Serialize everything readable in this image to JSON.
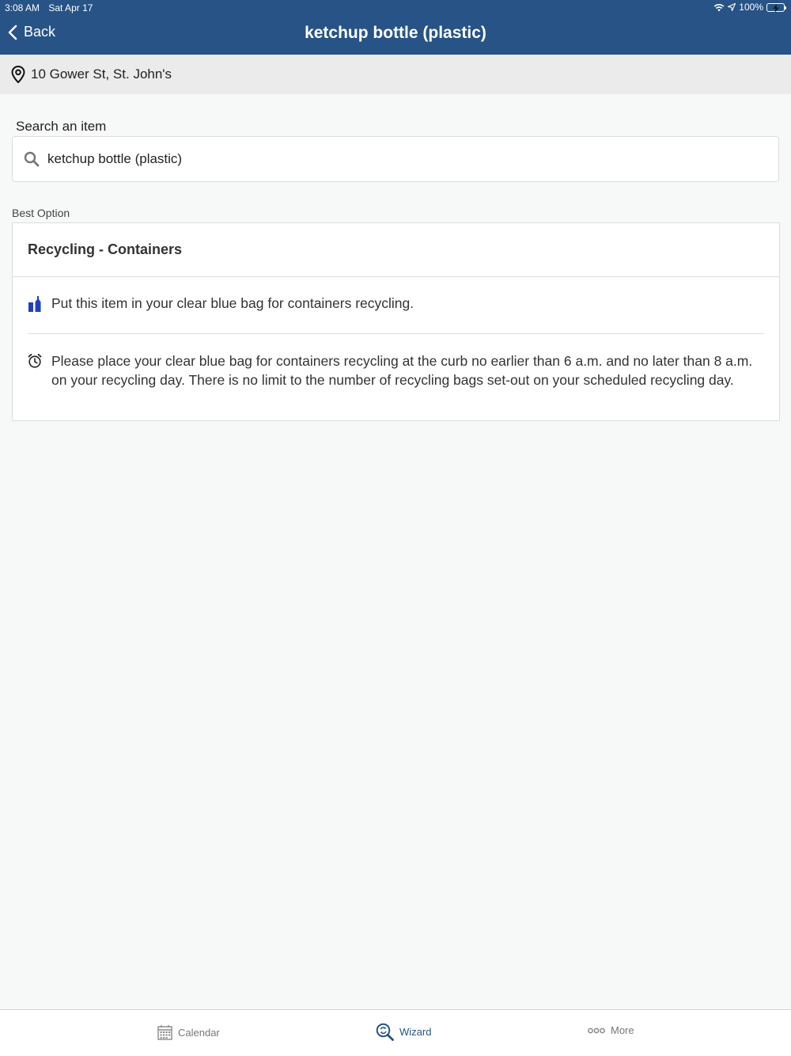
{
  "status_bar": {
    "time": "3:08 AM",
    "date": "Sat Apr 17",
    "battery": "100%"
  },
  "nav": {
    "back_label": "Back",
    "title": "ketchup bottle (plastic)"
  },
  "address": {
    "text": "10 Gower St, St. John's"
  },
  "search": {
    "label": "Search an item",
    "value": "ketchup bottle (plastic)"
  },
  "best_option": {
    "section_label": "Best Option",
    "title": "Recycling - Containers",
    "instruction": "Put this item in your clear blue bag for containers recycling.",
    "schedule_note": "Please place your clear blue bag for containers recycling at the curb no earlier than 6 a.m. and no later than 8 a.m. on your recycling day. There is no limit to the number of recycling bags set-out on your scheduled recycling day."
  },
  "tabs": [
    {
      "label": "Calendar",
      "icon": "calendar-icon"
    },
    {
      "label": "Wizard",
      "icon": "wizard-search-icon",
      "active": true
    },
    {
      "label": "More",
      "icon": "more-dots-icon"
    }
  ],
  "colors": {
    "header": "#275386",
    "accent": "#275386",
    "container_icon": "#1f3fc1",
    "battery": "#4cd964"
  }
}
